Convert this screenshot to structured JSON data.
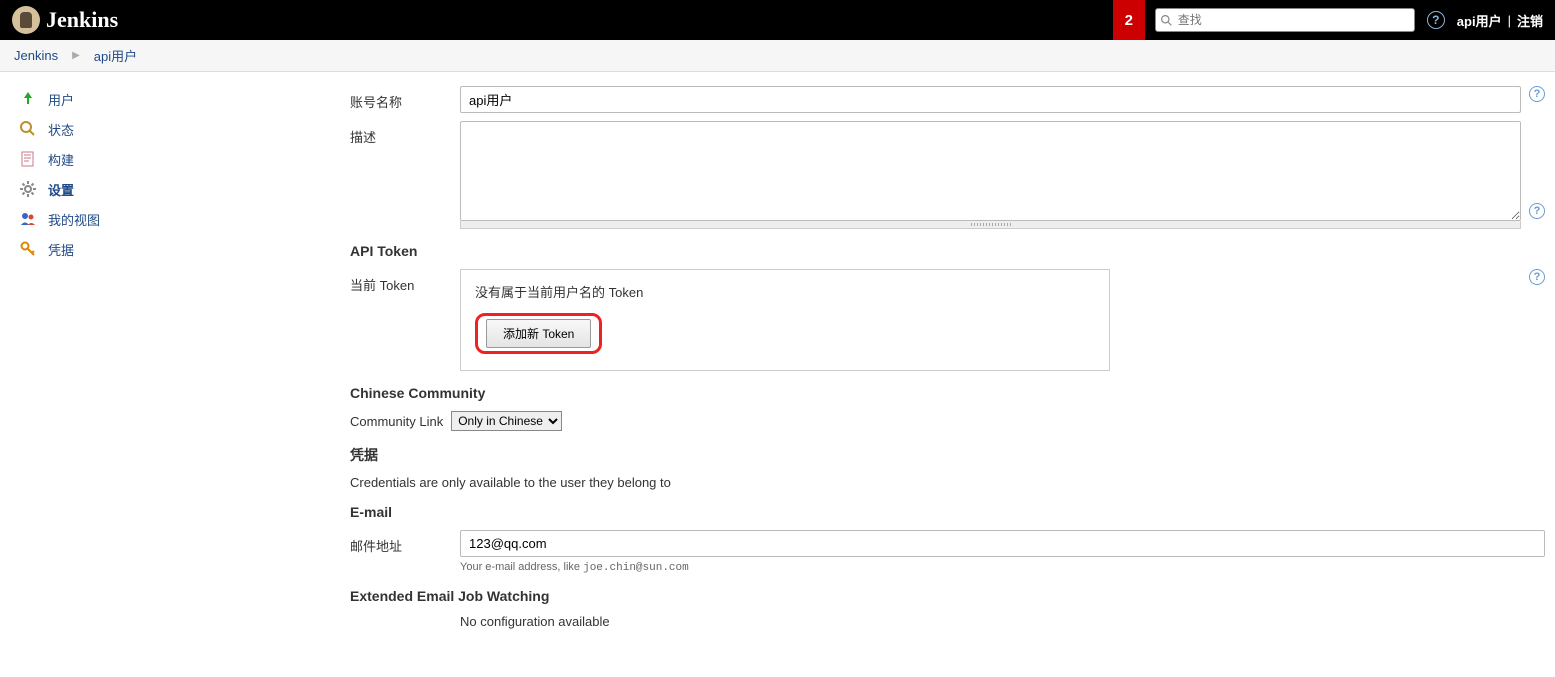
{
  "header": {
    "logo_text": "Jenkins",
    "notif_count": "2",
    "search_placeholder": "查找",
    "user_link": "api用户",
    "logout_link": "注销"
  },
  "breadcrumb": {
    "items": [
      "Jenkins",
      "api用户"
    ]
  },
  "sidebar": {
    "items": [
      {
        "label": "用户",
        "icon": "user-up"
      },
      {
        "label": "状态",
        "icon": "search"
      },
      {
        "label": "构建",
        "icon": "doc"
      },
      {
        "label": "设置",
        "icon": "gear",
        "active": true
      },
      {
        "label": "我的视图",
        "icon": "people"
      },
      {
        "label": "凭据",
        "icon": "key"
      }
    ]
  },
  "form": {
    "account_label": "账号名称",
    "account_value": "api用户",
    "desc_label": "描述",
    "desc_value": "",
    "api_token_header": "API Token",
    "current_token_label": "当前 Token",
    "no_token_msg": "没有属于当前用户名的 Token",
    "add_token_btn": "添加新 Token",
    "chinese_header": "Chinese Community",
    "community_link_label": "Community Link",
    "community_select": "Only in Chinese",
    "cred_header": "凭据",
    "cred_note": "Credentials are only available to the user they belong to",
    "email_header": "E-mail",
    "email_label": "邮件地址",
    "email_value": "123@qq.com",
    "email_help_pre": "Your e-mail address, like ",
    "email_help_code": "joe.chin@sun.com",
    "ext_email_header": "Extended Email Job Watching",
    "no_config_msg": "No configuration available"
  }
}
